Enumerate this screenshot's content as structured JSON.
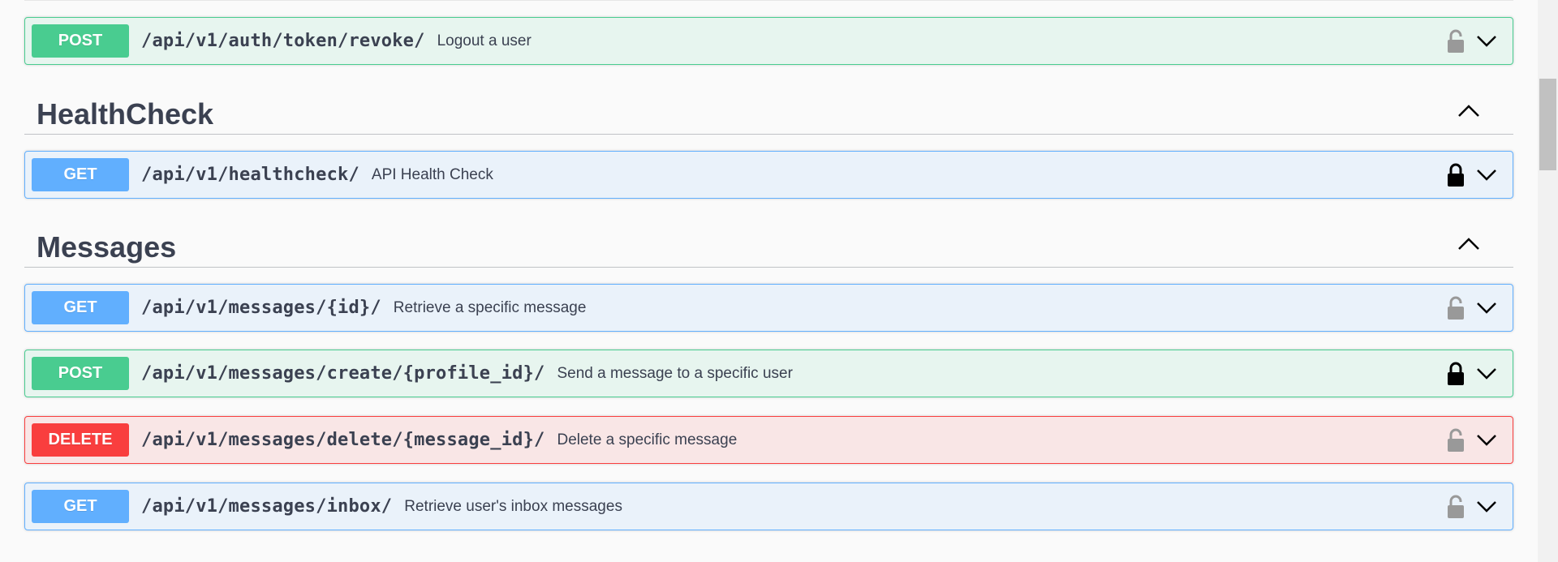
{
  "operations_auth": [
    {
      "method": "POST",
      "path": "/api/v1/auth/token/revoke/",
      "summary": "Logout a user",
      "locked": false
    }
  ],
  "sections": [
    {
      "title": "HealthCheck",
      "operations": [
        {
          "method": "GET",
          "path": "/api/v1/healthcheck/",
          "summary": "API Health Check",
          "locked": true
        }
      ]
    },
    {
      "title": "Messages",
      "operations": [
        {
          "method": "GET",
          "path": "/api/v1/messages/{id}/",
          "summary": "Retrieve a specific message",
          "locked": false
        },
        {
          "method": "POST",
          "path": "/api/v1/messages/create/{profile_id}/",
          "summary": "Send a message to a specific user",
          "locked": true
        },
        {
          "method": "DELETE",
          "path": "/api/v1/messages/delete/{message_id}/",
          "summary": "Delete a specific message",
          "locked": false
        },
        {
          "method": "GET",
          "path": "/api/v1/messages/inbox/",
          "summary": "Retrieve user's inbox messages",
          "locked": false
        }
      ]
    }
  ],
  "icons": {
    "lock_open": "unlocked-padlock-icon",
    "lock_closed": "locked-padlock-icon",
    "expand": "chevron-down-icon",
    "collapse": "chevron-up-icon"
  },
  "colors": {
    "post": "#49cc90",
    "get": "#61affe",
    "delete": "#f93e3e",
    "text": "#3b4151",
    "lock_open": "#999999",
    "lock_closed": "#000000"
  }
}
